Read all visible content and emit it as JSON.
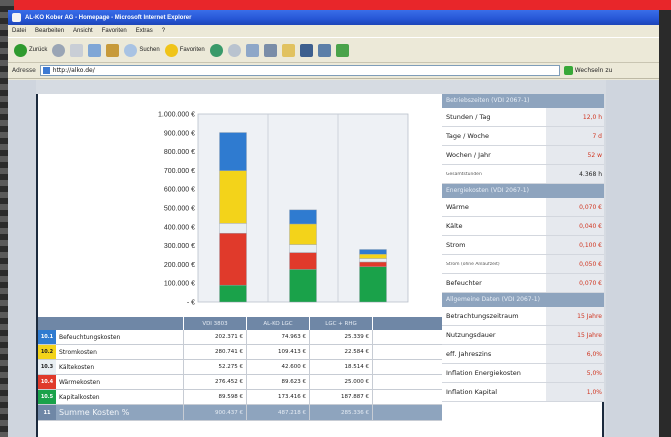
{
  "window": {
    "title": "AL-KO Kober AG - Homepage - Microsoft Internet Explorer",
    "menu": [
      "Datei",
      "Bearbeiten",
      "Ansicht",
      "Favoriten",
      "Extras",
      "?"
    ],
    "toolbar": {
      "back_label": "Zurück",
      "search_label": "Suchen",
      "favorites_label": "Favoriten"
    },
    "address": {
      "label": "Adresse",
      "url": "http://alko.de/",
      "go_label": "Wechseln zu"
    }
  },
  "chart_data": {
    "type": "bar",
    "stacked": true,
    "y_ticks": [
      "1.000.000 €",
      "900.000 €",
      "800.000 €",
      "700.000 €",
      "600.000 €",
      "500.000 €",
      "400.000 €",
      "300.000 €",
      "200.000 €",
      "100.000 €",
      "- €"
    ],
    "ylim": [
      0,
      1000000
    ],
    "categories": [
      "VDI 3803",
      "AL-KO LGC",
      "LGC + RHG"
    ],
    "series": [
      {
        "key": "10.5",
        "color": "#1aa24a",
        "values": [
          89598,
          173416,
          187887
        ]
      },
      {
        "key": "10.4",
        "color": "#e03a2b",
        "values": [
          276452,
          89623,
          25000
        ]
      },
      {
        "key": "10.3",
        "color": "#e8eef2",
        "values": [
          52275,
          42600,
          18514
        ]
      },
      {
        "key": "10.2",
        "color": "#f3d31a",
        "values": [
          280741,
          109413,
          22584
        ]
      },
      {
        "key": "10.1",
        "color": "#2f7bd0",
        "values": [
          202371,
          74963,
          25339
        ]
      }
    ]
  },
  "cost_table": {
    "headers": [
      "VDI 3803",
      "AL-KO LGC",
      "LGC + RHG"
    ],
    "rows": [
      {
        "key": "10.1",
        "label": "Befeuchtungskosten",
        "swatch": "#2f7bd0",
        "values": [
          "202.371 €",
          "74.963 €",
          "25.339 €"
        ]
      },
      {
        "key": "10.2",
        "label": "Stromkosten",
        "swatch": "#f3d31a",
        "values": [
          "280.741 €",
          "109.413 €",
          "22.584 €"
        ]
      },
      {
        "key": "10.3",
        "label": "Kältekosten",
        "swatch": "#e8eef2",
        "values": [
          "52.275 €",
          "42.600 €",
          "18.514 €"
        ]
      },
      {
        "key": "10.4",
        "label": "Wärmekosten",
        "swatch": "#e03a2b",
        "values": [
          "276.452 €",
          "89.623 €",
          "25.000 €"
        ]
      },
      {
        "key": "10.5",
        "label": "Kapitalkosten",
        "swatch": "#1aa24a",
        "values": [
          "89.598 €",
          "173.416 €",
          "187.887 €"
        ]
      }
    ],
    "sum": {
      "key": "11",
      "label": "Summe Kosten %",
      "values": [
        "900.437 €",
        "487.218 €",
        "285.336 €"
      ]
    }
  },
  "panel": {
    "section1": {
      "title": "Betriebszeiten (VDI 2067-1)",
      "rows": [
        {
          "label": "Stunden / Tag",
          "value": "12,0 h"
        },
        {
          "label": "Tage / Woche",
          "value": "7 d"
        },
        {
          "label": "Wochen / Jahr",
          "value": "52 w"
        },
        {
          "label": "Gesamtstunden",
          "value": "4.368 h"
        }
      ]
    },
    "section2": {
      "title": "Energiekosten (VDI 2067-1)",
      "rows": [
        {
          "label": "Wärme",
          "value": "0,070 €"
        },
        {
          "label": "Kälte",
          "value": "0,040 €"
        },
        {
          "label": "Strom",
          "value": "0,100 €"
        },
        {
          "label": "Strom (ohne Anlaufzeit)",
          "value": "0,050 €"
        },
        {
          "label": "Befeuchter",
          "value": "0,070 €"
        }
      ]
    },
    "section3": {
      "title": "Allgemeine Daten (VDI 2067-1)",
      "rows": [
        {
          "label": "Betrachtungszeitraum",
          "value": "15 Jahre"
        },
        {
          "label": "Nutzungsdauer",
          "value": "15 Jahre"
        },
        {
          "label": "eff. Jahreszins",
          "value": "6,0%"
        },
        {
          "label": "Inflation Energiekosten",
          "value": "5,0%"
        },
        {
          "label": "Inflation Kapital",
          "value": "1,0%"
        }
      ]
    }
  }
}
